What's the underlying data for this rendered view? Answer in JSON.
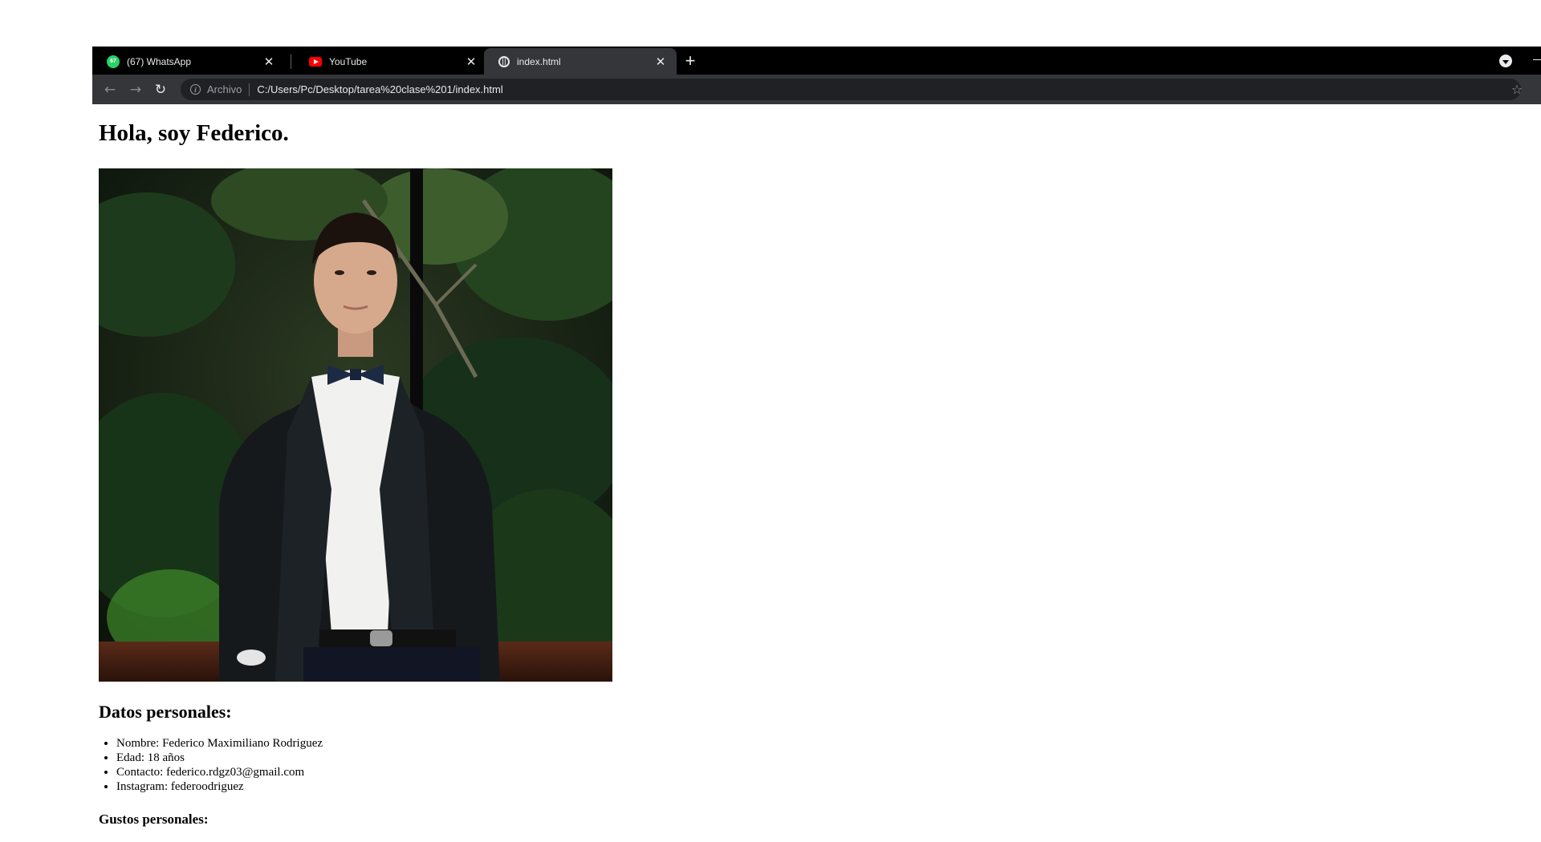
{
  "browser": {
    "tabs": [
      {
        "title": "(67) WhatsApp",
        "favicon": "whatsapp-icon",
        "badge": "67",
        "active": false
      },
      {
        "title": "YouTube",
        "favicon": "youtube-icon",
        "active": false
      },
      {
        "title": "index.html",
        "favicon": "globe-icon",
        "active": true
      }
    ],
    "close_glyph": "✕",
    "new_tab_glyph": "+",
    "toolbar": {
      "back_glyph": "←",
      "forward_glyph": "→",
      "reload_glyph": "↻",
      "info_glyph": "i",
      "origin_label": "Archivo",
      "url": "C:/Users/Pc/Desktop/tarea%20clase%201/index.html",
      "star_glyph": "☆"
    }
  },
  "page": {
    "heading": "Hola, soy Federico.",
    "datos_title": "Datos personales:",
    "datos_items": [
      "Nombre: Federico Maximiliano Rodriguez",
      "Edad: 18 años",
      "Contacto: federico.rdgz03@gmail.com",
      "Instagram: federoodriguez"
    ],
    "gustos_title": "Gustos personales:"
  },
  "colors": {
    "tabstrip": "#000000",
    "active_tab": "#35363a",
    "toolbar": "#35363a",
    "omnibox": "#202124",
    "text_light": "#e8eaed",
    "whatsapp": "#25d366",
    "youtube": "#ff0000"
  }
}
